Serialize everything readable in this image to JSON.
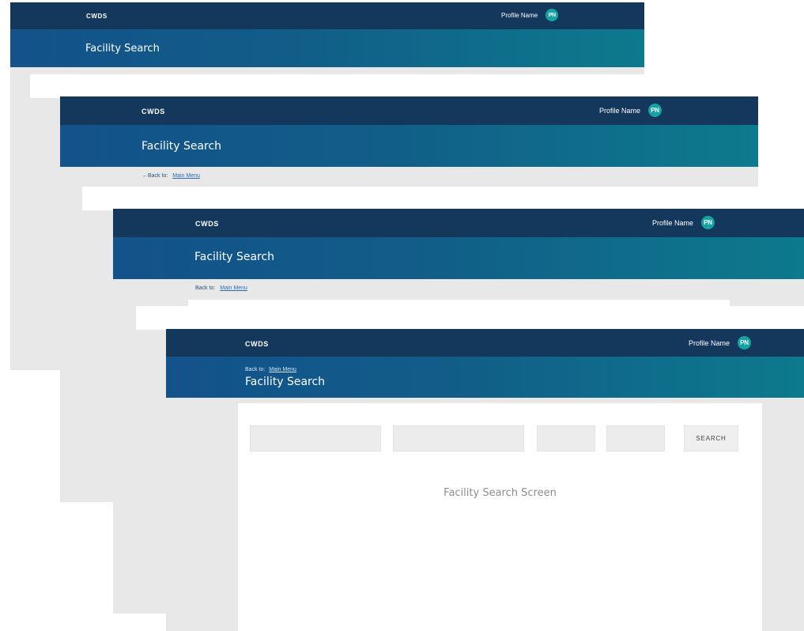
{
  "frames": [
    {
      "brand": "CWDS",
      "profile_name": "Profile Name",
      "avatar_initials": "PN",
      "title": "Facility Search",
      "back_prefix": "",
      "main_menu_label": ""
    },
    {
      "brand": "CWDS",
      "profile_name": "Profile Name",
      "avatar_initials": "PN",
      "title": "Facility Search",
      "back_prefix": "←Back to:",
      "main_menu_label": "Main Menu"
    },
    {
      "brand": "CWDS",
      "profile_name": "Profile Name",
      "avatar_initials": "PN",
      "title": "Facility Search",
      "back_prefix": "Back to:",
      "main_menu_label": "Main Menu"
    },
    {
      "brand": "CWDS",
      "profile_name": "Profile Name",
      "avatar_initials": "PN",
      "title": "Facility Search",
      "back_prefix": "Back to:",
      "main_menu_label": "Main Menu",
      "search_button": "SEARCH",
      "screen_label": "Facility Search Screen"
    }
  ],
  "colors": {
    "topbar": "#13385c",
    "header_gradient_start": "#13528a",
    "header_gradient_end": "#0d7a8d",
    "avatar": "#15a2a3",
    "canvas": "#e8e8e8"
  }
}
